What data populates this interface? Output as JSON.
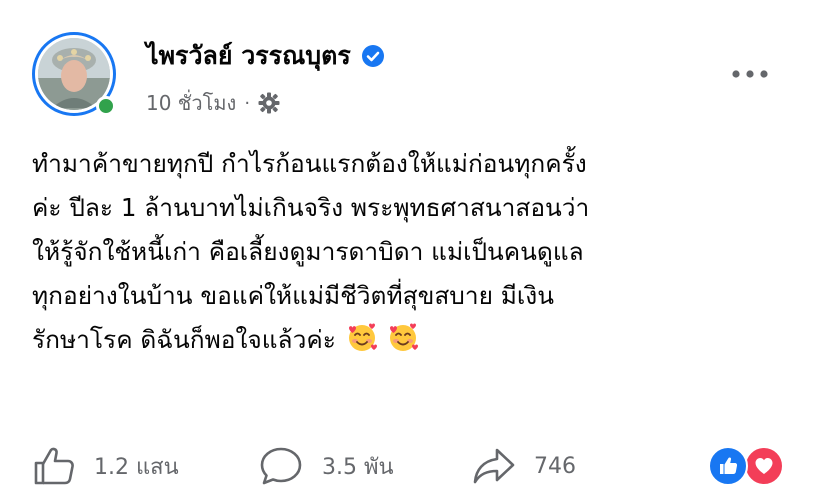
{
  "post": {
    "author": "ไพรวัลย์ วรรณบุตร",
    "verified": true,
    "timestamp": "10 ชั่วโมง",
    "separator": "·",
    "audience_icon": "gear-icon",
    "text_lines": [
      "ทำมาค้าขายทุกปี กำไรก้อนแรกต้องให้แม่ก่อนทุกครั้ง",
      "ค่ะ ปีละ 1 ล้านบาทไม่เกินจริง พระพุทธศาสนาสอนว่า",
      "ให้รู้จักใช้หนี้เก่า คือเลี้ยงดูมารดาบิดา แม่เป็นคนดูแล",
      "ทุกอย่างในบ้าน ขอแค่ให้แม่มีชีวิตที่สุขสบาย มีเงิน",
      "รักษาโรค ดิฉันก็พอใจแล้วค่ะ"
    ],
    "trailing_emojis": [
      "smiling-face-with-hearts-icon",
      "smiling-face-with-hearts-icon"
    ]
  },
  "actions": {
    "like_count": "1.2 แสน",
    "comment_count": "3.5 พัน",
    "share_count": "746"
  },
  "reactions": [
    "like-reaction-icon",
    "love-reaction-icon"
  ],
  "colors": {
    "verified_blue": "#1877f2",
    "online_green": "#31a24c",
    "secondary_text": "#65676b",
    "love_red": "#f33e58"
  }
}
